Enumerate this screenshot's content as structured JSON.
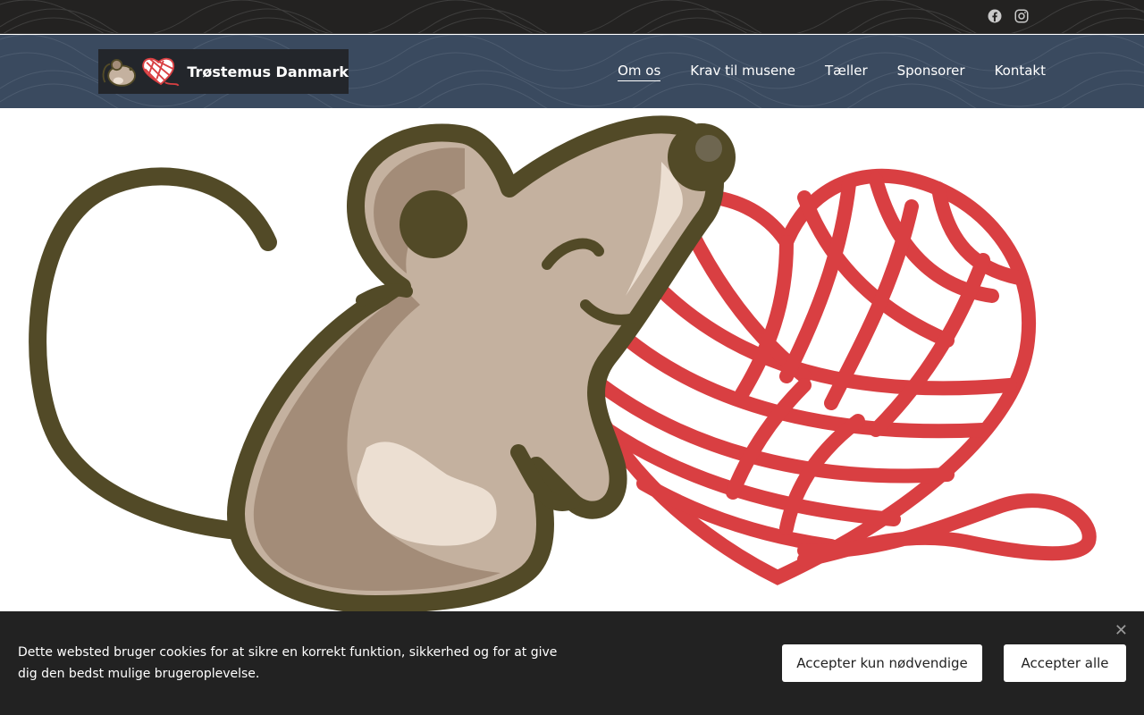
{
  "site": {
    "brand_name": "Trøstemus Danmark"
  },
  "social": {
    "icons": [
      "facebook-icon",
      "instagram-icon"
    ]
  },
  "nav": {
    "items": [
      {
        "label": "Om os",
        "active": true
      },
      {
        "label": "Krav til musene",
        "active": false
      },
      {
        "label": "Tæller",
        "active": false
      },
      {
        "label": "Sponsorer",
        "active": false
      },
      {
        "label": "Kontakt",
        "active": false
      }
    ]
  },
  "cookie_banner": {
    "text": "Dette websted bruger cookies for at sikre en korrekt funktion, sikkerhed og for at give dig den bedst mulige brugeroplevelse.",
    "necessary_label": "Accepter kun nødvendige",
    "accept_all_label": "Accepter alle",
    "close_glyph": "✕"
  },
  "colors": {
    "topbar": "#232221",
    "header": "#3a4a5f",
    "cookie_bg": "#222222",
    "mouse_outline": "#524a27",
    "mouse_body": "#c4b19f",
    "mouse_shade": "#a38c78",
    "mouse_light": "#ecdfd2",
    "yarn_red": "#d93f42"
  }
}
